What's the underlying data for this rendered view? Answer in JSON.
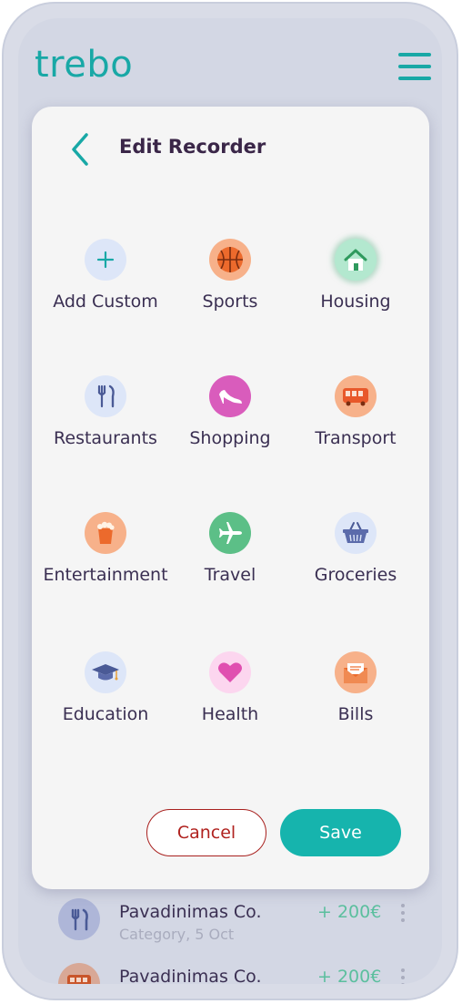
{
  "app": {
    "logo": "trebo"
  },
  "modal": {
    "title": "Edit Recorder",
    "categories": [
      {
        "label": "Add Custom",
        "icon": "plus-icon",
        "bg": "#dde6f8"
      },
      {
        "label": "Sports",
        "icon": "basketball-icon",
        "bg": "#f7b18a"
      },
      {
        "label": "Housing",
        "icon": "house-icon",
        "bg": "#b3e8cf"
      },
      {
        "label": "Restaurants",
        "icon": "fork-knife-icon",
        "bg": "#dde6f8"
      },
      {
        "label": "Shopping",
        "icon": "high-heel-icon",
        "bg": "#d95cbc"
      },
      {
        "label": "Transport",
        "icon": "bus-icon",
        "bg": "#f7b18a"
      },
      {
        "label": "Entertainment",
        "icon": "popcorn-icon",
        "bg": "#f7b18a"
      },
      {
        "label": "Travel",
        "icon": "airplane-icon",
        "bg": "#5cbf87"
      },
      {
        "label": "Groceries",
        "icon": "basket-icon",
        "bg": "#dde6f8"
      },
      {
        "label": "Education",
        "icon": "graduation-cap-icon",
        "bg": "#dde6f8"
      },
      {
        "label": "Health",
        "icon": "heart-icon",
        "bg": "#fcd6ef"
      },
      {
        "label": "Bills",
        "icon": "envelope-icon",
        "bg": "#f7b18a"
      }
    ],
    "cancel_label": "Cancel",
    "save_label": "Save"
  },
  "transactions": [
    {
      "name": "Pavadinimas Co.",
      "subtitle": "Category, 5 Oct",
      "amount": "+ 200€",
      "icon": "fork-knife-icon"
    },
    {
      "name": "Pavadinimas Co.",
      "subtitle": "",
      "amount": "+ 200€",
      "icon": "bus-icon"
    }
  ],
  "colors": {
    "accent": "#18a8a6",
    "save": "#16b4ad",
    "cancel": "#b0221f",
    "title": "#3a2648"
  }
}
